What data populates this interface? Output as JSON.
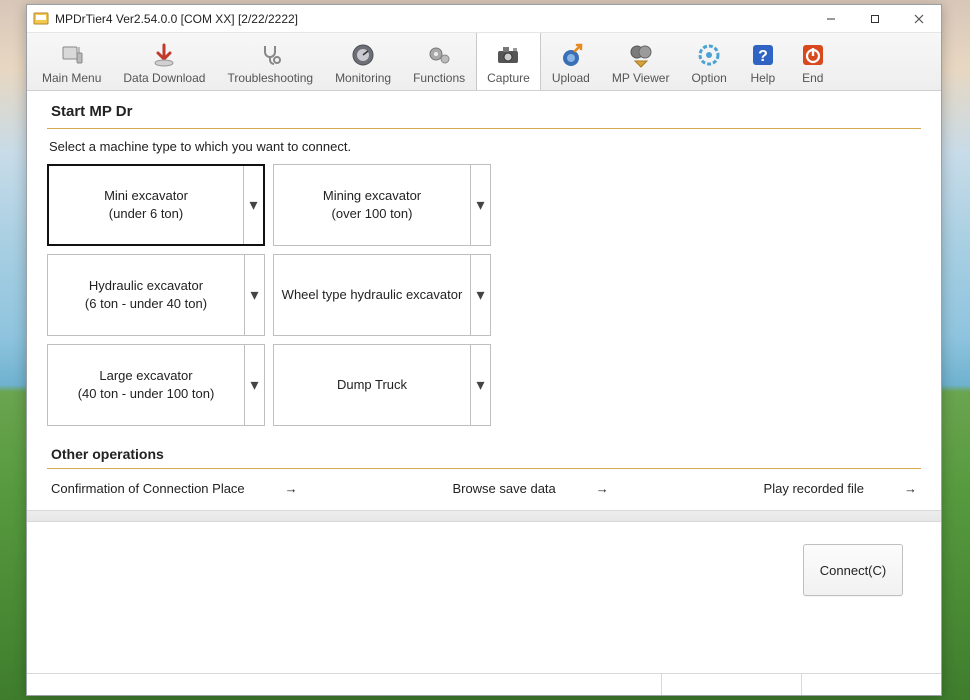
{
  "window": {
    "title": "MPDrTier4 Ver2.54.0.0 [COM XX] [2/22/2222]"
  },
  "toolbar": [
    {
      "id": "main-menu",
      "label": "Main Menu",
      "active": false
    },
    {
      "id": "data-download",
      "label": "Data Download",
      "active": false
    },
    {
      "id": "troubleshooting",
      "label": "Troubleshooting",
      "active": false
    },
    {
      "id": "monitoring",
      "label": "Monitoring",
      "active": false
    },
    {
      "id": "functions",
      "label": "Functions",
      "active": false
    },
    {
      "id": "capture",
      "label": "Capture",
      "active": true
    },
    {
      "id": "upload",
      "label": "Upload",
      "active": false
    },
    {
      "id": "mp-viewer",
      "label": "MP Viewer",
      "active": false
    },
    {
      "id": "option",
      "label": "Option",
      "active": false
    },
    {
      "id": "help",
      "label": "Help",
      "active": false
    },
    {
      "id": "end",
      "label": "End",
      "active": false
    }
  ],
  "page": {
    "header": "Start MP Dr",
    "prompt": "Select a machine type to which you want to connect.",
    "other_operations_header": "Other operations"
  },
  "machines": [
    {
      "line1": "Mini excavator",
      "line2": "(under 6 ton)",
      "selected": true
    },
    {
      "line1": "Mining excavator",
      "line2": "(over 100 ton)",
      "selected": false
    },
    {
      "line1": "Hydraulic excavator",
      "line2": "(6 ton - under 40 ton)",
      "selected": false
    },
    {
      "line1": "Wheel type hydraulic excavator",
      "line2": "",
      "selected": false
    },
    {
      "line1": "Large excavator",
      "line2": "(40 ton - under 100 ton)",
      "selected": false
    },
    {
      "line1": "Dump Truck",
      "line2": "",
      "selected": false
    }
  ],
  "operations": [
    {
      "label": "Confirmation of Connection Place"
    },
    {
      "label": "Browse save data"
    },
    {
      "label": "Play recorded file"
    }
  ],
  "footer": {
    "connect_label": "Connect(C)"
  }
}
